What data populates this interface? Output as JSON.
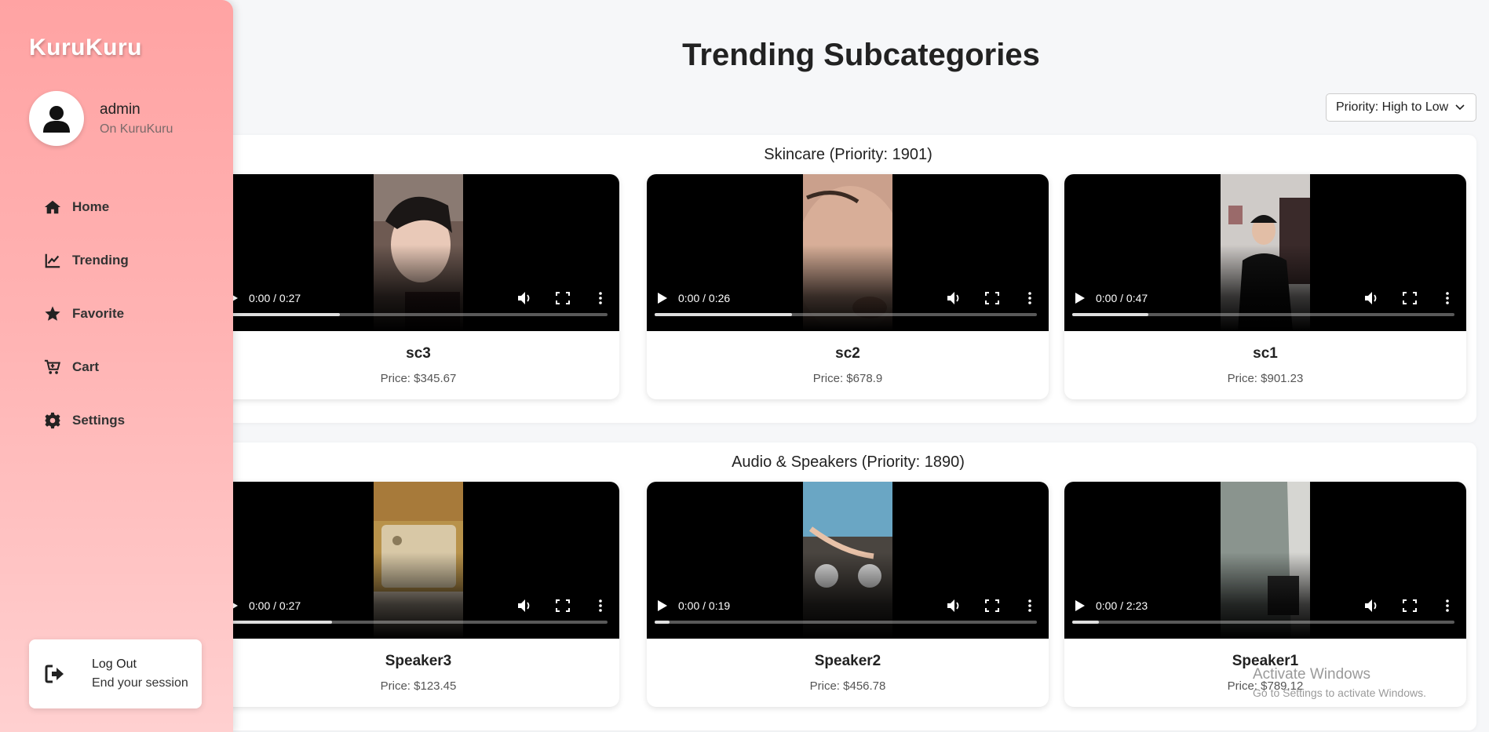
{
  "sidebar": {
    "brand": "KuruKuru",
    "user": {
      "name": "admin",
      "subtitle": "On KuruKuru"
    },
    "nav": [
      {
        "label": "Home",
        "icon": "home-icon"
      },
      {
        "label": "Trending",
        "icon": "chart-line-icon"
      },
      {
        "label": "Favorite",
        "icon": "star-icon"
      },
      {
        "label": "Cart",
        "icon": "cart-icon"
      },
      {
        "label": "Settings",
        "icon": "gear-icon"
      }
    ],
    "logout": {
      "title": "Log Out",
      "subtitle": "End your session",
      "icon": "sign-out-icon"
    }
  },
  "main": {
    "title": "Trending Subcategories",
    "sort": {
      "selected": "Priority: High to Low"
    },
    "sections": [
      {
        "title": "Skincare (Priority: 1901)",
        "items": [
          {
            "name": "sc3",
            "price": "Price: $345.67",
            "time": "0:00 / 0:27",
            "progress": 0.3
          },
          {
            "name": "sc2",
            "price": "Price: $678.9",
            "time": "0:00 / 0:26",
            "progress": 0.36
          },
          {
            "name": "sc1",
            "price": "Price: $901.23",
            "time": "0:00 / 0:47",
            "progress": 0.2
          }
        ]
      },
      {
        "title": "Audio & Speakers (Priority: 1890)",
        "items": [
          {
            "name": "Speaker3",
            "price": "Price: $123.45",
            "time": "0:00 / 0:27",
            "progress": 0.28
          },
          {
            "name": "Speaker2",
            "price": "Price: $456.78",
            "time": "0:00 / 0:19",
            "progress": 0.04
          },
          {
            "name": "Speaker1",
            "price": "Price: $789.12",
            "time": "0:00 / 2:23",
            "progress": 0.07
          }
        ]
      }
    ]
  },
  "watermark": {
    "line1": "Activate Windows",
    "line2": "Go to Settings to activate Windows."
  }
}
